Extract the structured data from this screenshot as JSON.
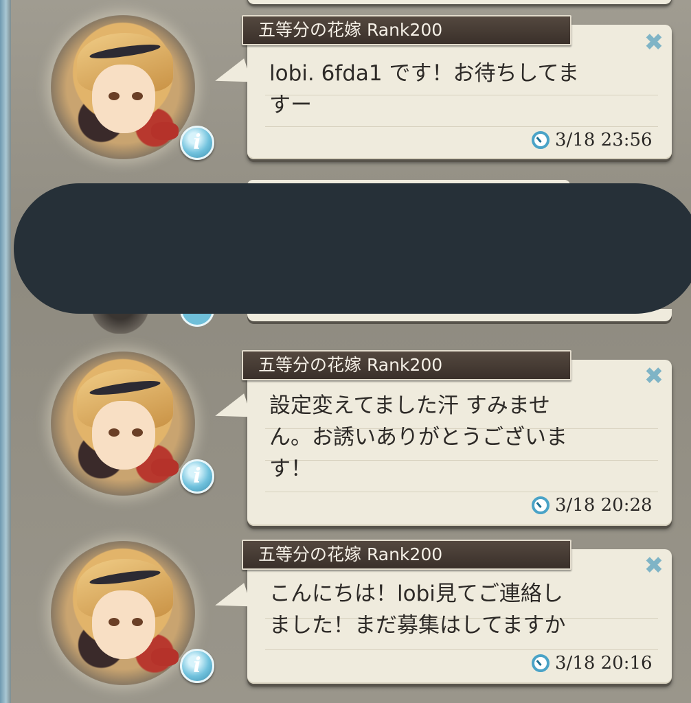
{
  "messages": [
    {
      "sender": "五等分の花嫁 Rank200",
      "text": "lobi. 6fda1 です！お待ちしてま\nすー",
      "time": "3/18 23:56"
    },
    {
      "sender": "五等分の花嫁 Rank200",
      "text": "設定変えてました汗 すみませ\nん。お誘いありがとうございま\nす！",
      "time": "3/18 20:28"
    },
    {
      "sender": "五等分の花嫁 Rank200",
      "text": "こんにちは！lobi見てご連絡し\nました！まだ募集はしてますか",
      "time": "3/18 20:16"
    }
  ],
  "icons": {
    "info": "i",
    "close": "✖",
    "clock": "clock-icon"
  },
  "colors": {
    "bubble": "#efebdd",
    "name_tag": "#3a302a",
    "accent_blue": "#4aa3c7",
    "redaction": "#263038"
  }
}
